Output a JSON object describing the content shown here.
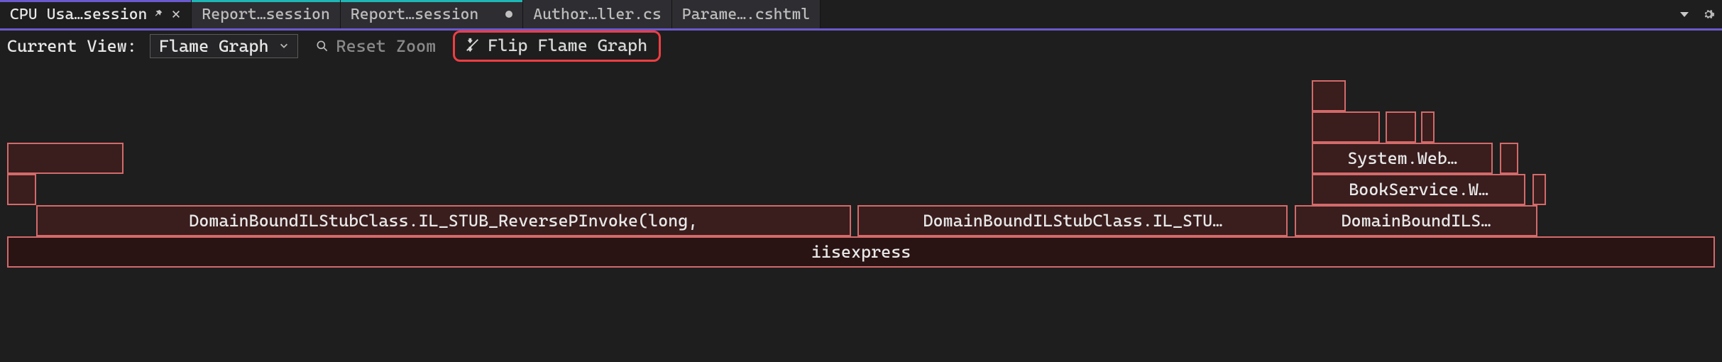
{
  "colors": {
    "accent_purple": "#6a5acd",
    "accent_teal": "#1fb6b6",
    "flame_border": "#d36a6a",
    "flame_fill": "#3a1d1d",
    "flame_fill_dark": "#2a1313",
    "highlight": "#ef3e42"
  },
  "tabs": [
    {
      "label": "CPU Usa…session",
      "active": true,
      "pinned": true,
      "accent": "purple",
      "closeable": true
    },
    {
      "label": "Report…session",
      "active": false,
      "accent": "teal"
    },
    {
      "label": "Report…session",
      "active": false,
      "accent": "teal",
      "dirty": true
    },
    {
      "label": "Author…ller.cs",
      "active": false
    },
    {
      "label": "Parame….cshtml",
      "active": false
    }
  ],
  "toolbar": {
    "current_view_label": "Current View:",
    "dropdown_value": "Flame Graph",
    "reset_zoom": "Reset Zoom",
    "flip_flame": "Flip Flame Graph"
  },
  "flame": {
    "root": {
      "label": "iisexpress",
      "left": 0.0,
      "width": 1.0
    },
    "row_b": [
      {
        "label": "DomainBoundILStubClass.IL_STUB_ReversePInvoke(long,",
        "left": 0.017,
        "width": 0.477
      },
      {
        "label": "DomainBoundILStubClass.IL_STU…",
        "left": 0.498,
        "width": 0.252
      },
      {
        "label": "DomainBoundILS…",
        "left": 0.754,
        "width": 0.142
      }
    ],
    "row_c": [
      {
        "label": "",
        "left": 0.0,
        "width": 0.017
      },
      {
        "label": "BookService.W…",
        "left": 0.764,
        "width": 0.125
      },
      {
        "label": "",
        "left": 0.893,
        "width": 0.008
      }
    ],
    "row_d": [
      {
        "label": "",
        "left": 0.0,
        "width": 0.068
      },
      {
        "label": "System.Web…",
        "left": 0.764,
        "width": 0.106
      },
      {
        "label": "",
        "left": 0.874,
        "width": 0.011
      }
    ],
    "row_e": [
      {
        "label": "",
        "left": 0.764,
        "width": 0.04
      },
      {
        "label": "",
        "left": 0.807,
        "width": 0.018
      },
      {
        "label": "",
        "left": 0.828,
        "width": 0.008
      }
    ],
    "row_f": [
      {
        "label": "",
        "left": 0.764,
        "width": 0.02
      }
    ]
  }
}
